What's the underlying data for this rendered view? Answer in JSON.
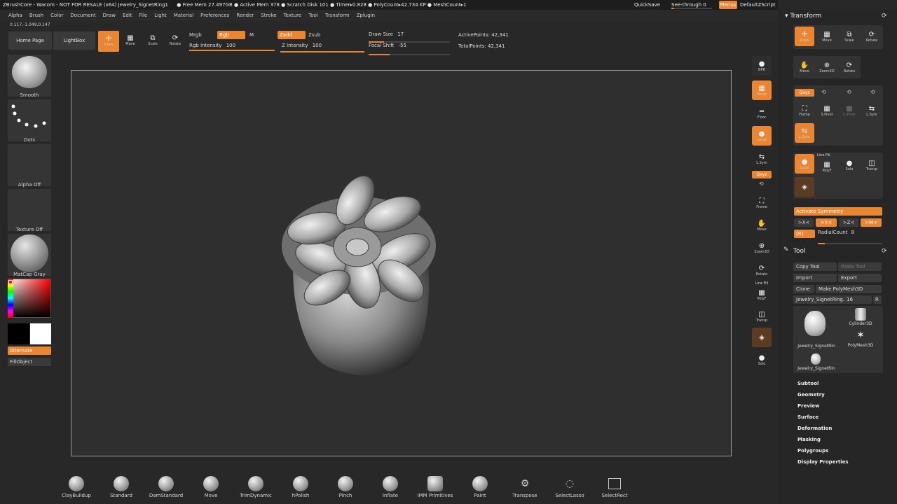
{
  "titlebar": {
    "title": "ZBrushCore - Wacom - NOT FOR RESALE (x64)  Jewelry_SignetRing1",
    "stats": "● Free Mem 27.497GB  ● Active Mem 378  ● Scratch Disk 101  ● Timer▸0.828  ● PolyCount▸42.734 KP  ● MeshCount▸1",
    "quicksave": "QuickSave",
    "seethrough": "See-through  0",
    "menus": "Menus",
    "script": "DefaultZScript"
  },
  "menubar": [
    "Alpha",
    "Brush",
    "Color",
    "Document",
    "Draw",
    "Edit",
    "File",
    "Light",
    "Material",
    "Preferences",
    "Render",
    "Stroke",
    "Texture",
    "Tool",
    "Transform",
    "Zplugin"
  ],
  "coords": "0.117,-1.049,0.147",
  "toolbar": {
    "home": "Home Page",
    "lightbox": "LightBox",
    "draw": "Draw",
    "move": "Move",
    "scale": "Scale",
    "rotate": "Rotate",
    "mrgb": "Mrgb",
    "rgb": "Rgb",
    "m": "M",
    "rgb_intensity": "Rgb Intensity",
    "rgb_intensity_val": "100",
    "zadd": "Zadd",
    "zsub": "Zsub",
    "z_intensity": "Z Intensity",
    "z_intensity_val": "100",
    "draw_size": "Draw Size",
    "draw_size_val": "17",
    "focal_shift": "Focal Shift",
    "focal_shift_val": "-55",
    "active_points": "ActivePoints: 42,341",
    "total_points": "TotalPoints: 42,341"
  },
  "left": {
    "smooth": "Smooth",
    "dots": "Dots",
    "alpha": "Alpha Off",
    "texture": "Texture Off",
    "matcap": "MatCap Gray",
    "alternate": "Alternate",
    "fillobject": "FillObject"
  },
  "shelf": {
    "bpr": "BPR",
    "persp": "Persp",
    "floor": "Floor",
    "local": "Local",
    "lsym": "L.Sym",
    "xyz": "Qxyz",
    "frame": "Frame",
    "move": "Move",
    "zoom": "Zoom3D",
    "rotate": "Rotate",
    "linefill": "Line Fill",
    "polyf": "PolyF",
    "transp": "Transp",
    "solo": "Solo"
  },
  "brushes": [
    "ClayBuildup",
    "Standard",
    "DamStandard",
    "Move",
    "TrimDynamic",
    "hPolish",
    "Pinch",
    "Inflate",
    "IMM Primitives",
    "Paint",
    "Transpose",
    "SelectLasso",
    "SelectRect"
  ],
  "transform": {
    "title": "Transform",
    "draw": "Draw",
    "move": "Move",
    "scale": "Scale",
    "rotate": "Rotate",
    "move2": "Move",
    "zoom": "Zoom3D",
    "rotate2": "Rotate",
    "xyz": "Qxyz",
    "frame": "Frame",
    "spivot": "S.Pivot",
    "cpivot": "C.Pivot",
    "lsym": "L.Sym",
    "lsym2": "L.Sym",
    "linefill": "Line Fill",
    "local": "Local",
    "polyf": "PolyF",
    "solo": "Solo",
    "transp": "Transp",
    "activate_sym": "Activate Symmetry",
    "x": ">X<",
    "y": ">Y<",
    "z": ">Z<",
    "m": ">M<",
    "r": "(R)",
    "radial": "RadialCount",
    "radial_val": "8"
  },
  "tool": {
    "title": "Tool",
    "copy": "Copy Tool",
    "paste": "Paste Tool",
    "import": "Import",
    "export": "Export",
    "clone": "Clone",
    "makepoly": "Make PolyMesh3D",
    "current": "Jewelry_SignetRing.",
    "current_val": "16",
    "r": "R",
    "thumb1": "Jewelry_SignetRin",
    "thumb2": "Cylinder3D",
    "thumb3": "PolyMesh3D",
    "thumb4": "Jewelry_SignetRin",
    "sections": [
      "Subtool",
      "Geometry",
      "Preview",
      "Surface",
      "Deformation",
      "Masking",
      "Polygroups",
      "Display Properties"
    ]
  }
}
